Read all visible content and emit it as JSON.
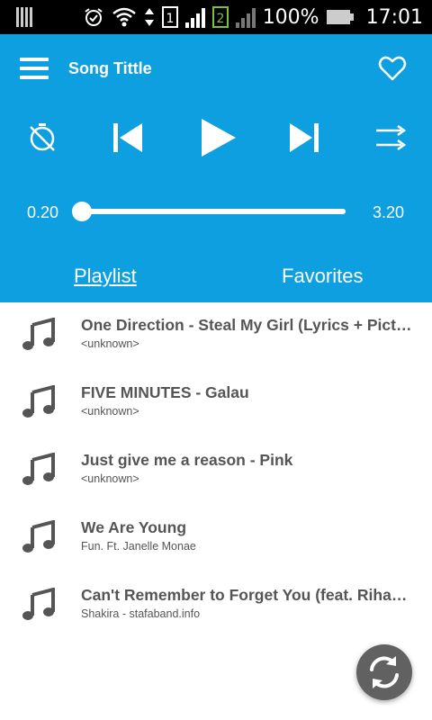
{
  "status_bar": {
    "battery_text": "100%",
    "time": "17:01",
    "sim1": "1",
    "sim2": "2",
    "icons": [
      "barcode-icon",
      "alarm-icon",
      "wifi-icon",
      "data-arrows-icon",
      "sim1-icon",
      "signal1-icon",
      "sim2-icon",
      "signal2-icon",
      "battery-icon"
    ]
  },
  "header": {
    "title": "Song Tittle",
    "menu_icon": "hamburger-menu-icon",
    "favorite_icon": "heart-outline-icon"
  },
  "controls": {
    "icons": [
      "timer-off-icon",
      "skip-previous-icon",
      "play-icon",
      "skip-next-icon",
      "shuffle-icon"
    ]
  },
  "seekbar": {
    "current": "0.20",
    "total": "3.20",
    "progress_fraction": 0.0
  },
  "tabs": [
    {
      "label": "Playlist",
      "active": true
    },
    {
      "label": "Favorites",
      "active": false
    }
  ],
  "playlist": [
    {
      "title": "One Direction - Steal My Girl (Lyrics + Pictures)",
      "subtitle": "<unknown>"
    },
    {
      "title": "FIVE MINUTES - Galau",
      "subtitle": "<unknown>"
    },
    {
      "title": "Just give me a reason - Pink",
      "subtitle": "<unknown>"
    },
    {
      "title": "We Are Young",
      "subtitle": "Fun. Ft. Janelle Monae"
    },
    {
      "title": "Can't Remember to Forget You (feat. Rihanna)",
      "subtitle": "Shakira - stafaband.info"
    }
  ],
  "fab": {
    "icon": "refresh-sync-icon"
  },
  "colors": {
    "primary": "#0d9fe0",
    "status_bar": "#000000",
    "text_dark": "#555555",
    "fab": "#616161",
    "sim2_green": "#7ac142"
  }
}
